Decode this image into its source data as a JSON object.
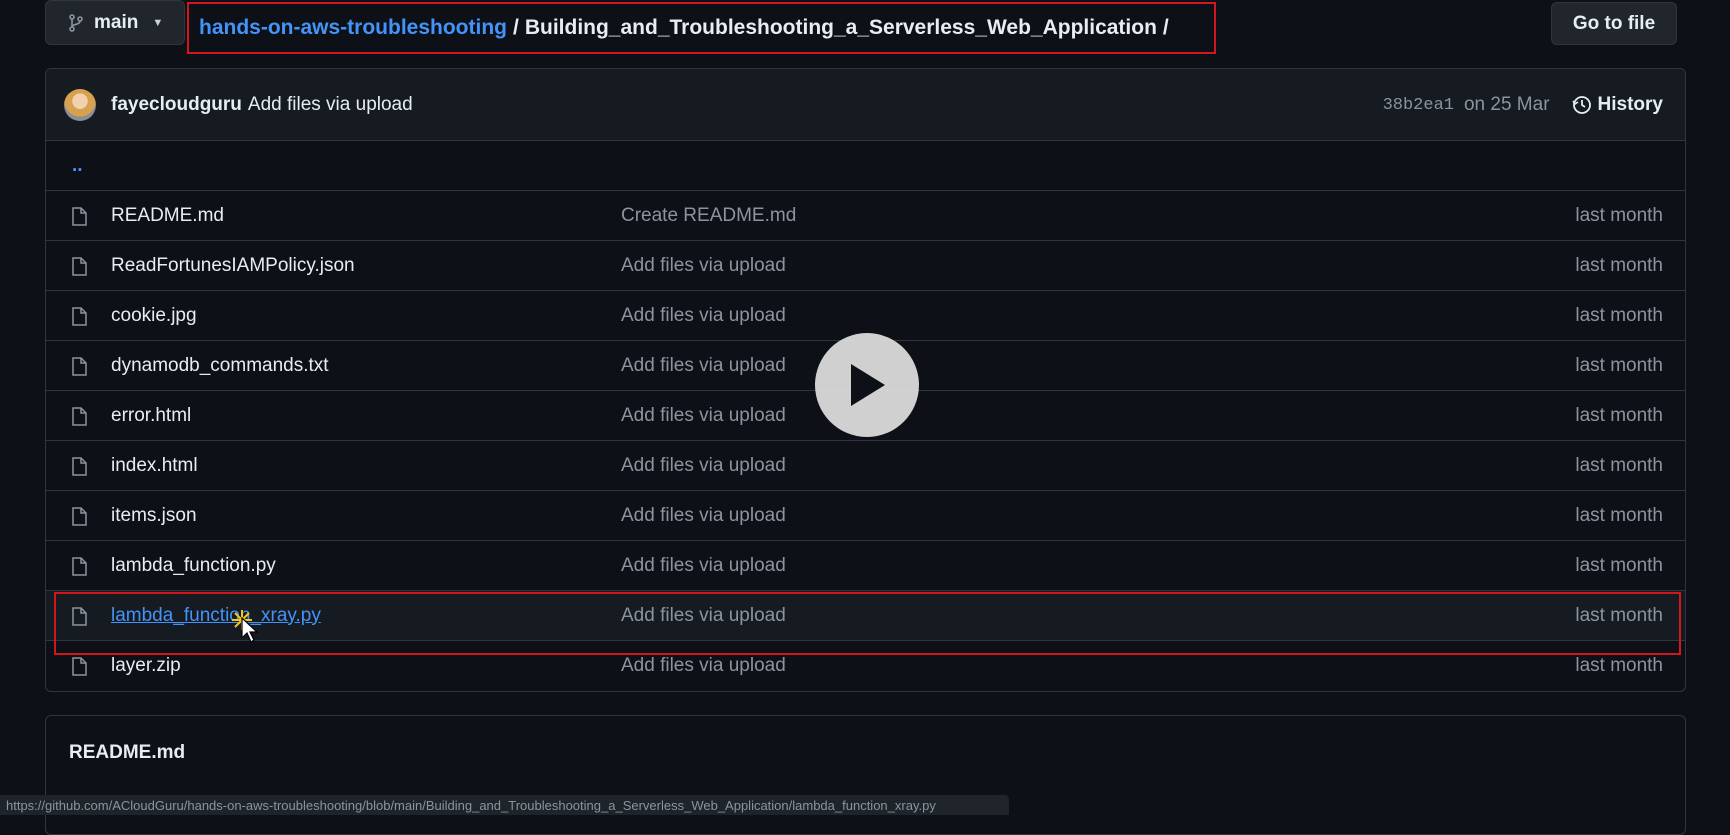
{
  "header": {
    "branch": "main",
    "repo": "hands-on-aws-troubleshooting",
    "sep1": "/",
    "dir": "Building_and_Troubleshooting_a_Serverless_Web_Application",
    "sep2": "/",
    "goto_label": "Go to file"
  },
  "commit": {
    "author": "fayecloudguru",
    "message": "Add files via upload",
    "sha": "38b2ea1",
    "date": "on 25 Mar",
    "history_label": "History"
  },
  "updir": "..",
  "files": [
    {
      "name": "README.md",
      "message": "Create README.md",
      "age": "last month"
    },
    {
      "name": "ReadFortunesIAMPolicy.json",
      "message": "Add files via upload",
      "age": "last month"
    },
    {
      "name": "cookie.jpg",
      "message": "Add files via upload",
      "age": "last month"
    },
    {
      "name": "dynamodb_commands.txt",
      "message": "Add files via upload",
      "age": "last month"
    },
    {
      "name": "error.html",
      "message": "Add files via upload",
      "age": "last month"
    },
    {
      "name": "index.html",
      "message": "Add files via upload",
      "age": "last month"
    },
    {
      "name": "items.json",
      "message": "Add files via upload",
      "age": "last month"
    },
    {
      "name": "lambda_function.py",
      "message": "Add files via upload",
      "age": "last month"
    },
    {
      "name": "lambda_function_xray.py",
      "message": "Add files via upload",
      "age": "last month"
    },
    {
      "name": "layer.zip",
      "message": "Add files via upload",
      "age": "last month"
    }
  ],
  "readme": {
    "title": "README.md"
  },
  "status_url": "https://github.com/ACloudGuru/hands-on-aws-troubleshooting/blob/main/Building_and_Troubleshooting_a_Serverless_Web_Application/lambda_function_xray.py",
  "colors": {
    "accent": "#4493f8",
    "highlight": "#d1161e",
    "background": "#0d1117"
  },
  "icons": [
    "branch-icon",
    "caret-down-icon",
    "history-icon",
    "file-icon",
    "play-icon",
    "cursor-icon"
  ]
}
